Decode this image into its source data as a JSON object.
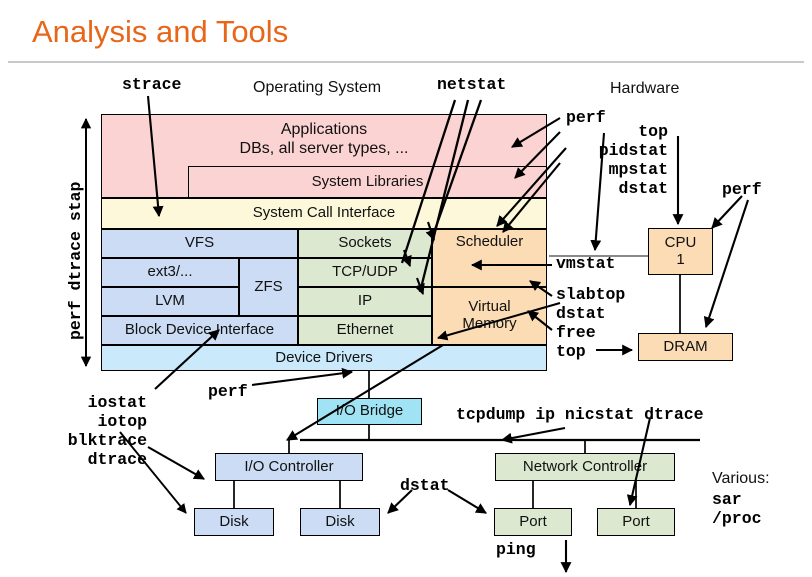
{
  "slide": {
    "title": "Analysis and Tools"
  },
  "headings": {
    "operating_system": "Operating System",
    "hardware": "Hardware"
  },
  "axis": {
    "vertical_label": "perf dtrace stap"
  },
  "os_stack": {
    "applications_line1": "Applications",
    "applications_line2": "DBs, all server types, ...",
    "system_libraries": "System Libraries",
    "system_call_interface": "System Call Interface",
    "device_drivers": "Device Drivers",
    "file_system_column": [
      "VFS",
      "ext3/...",
      "ZFS",
      "LVM",
      "Block Device Interface"
    ],
    "network_column": [
      "Sockets",
      "TCP/UDP",
      "IP",
      "Ethernet"
    ],
    "other_column": [
      "Scheduler",
      "Virtual Memory"
    ],
    "virtual_memory_line1": "Virtual",
    "virtual_memory_line2": "Memory"
  },
  "hardware": {
    "cpu_line1": "CPU",
    "cpu_line2": "1",
    "dram": "DRAM",
    "io_bridge": "I/O Bridge",
    "io_controller": "I/O Controller",
    "disk_1": "Disk",
    "disk_2": "Disk",
    "network_controller": "Network Controller",
    "port_1": "Port",
    "port_2": "Port"
  },
  "tools": {
    "strace": "strace",
    "netstat": "netstat",
    "perf_top_right": "perf",
    "cpu_tools": "top\npidstat\nmpstat\ndstat",
    "perf_cpu": "perf",
    "vmstat": "vmstat",
    "memory_tools": "slabtop\ndstat\nfree\ntop",
    "disk_tools": "iostat\niotop\nblktrace\ndtrace",
    "perf_bridge": "perf",
    "dstat_bottom": "dstat",
    "network_tools": "tcpdump ip nicstat dtrace",
    "ping": "ping",
    "various_label": "Various:",
    "various_tools": "sar\n/proc"
  },
  "colors": {
    "title": "#E8661A",
    "applications": "#FCD3D3",
    "syscall": "#FCF8D9",
    "filesystem": "#CCDCF5",
    "network": "#DCE9D0",
    "scheduler_memory": "#FBDCB4",
    "device_drivers": "#CAEAFB",
    "io_bridge": "#9FE3F5",
    "hardware_cpu": "#FBDCB4",
    "stroke": "#000000"
  }
}
